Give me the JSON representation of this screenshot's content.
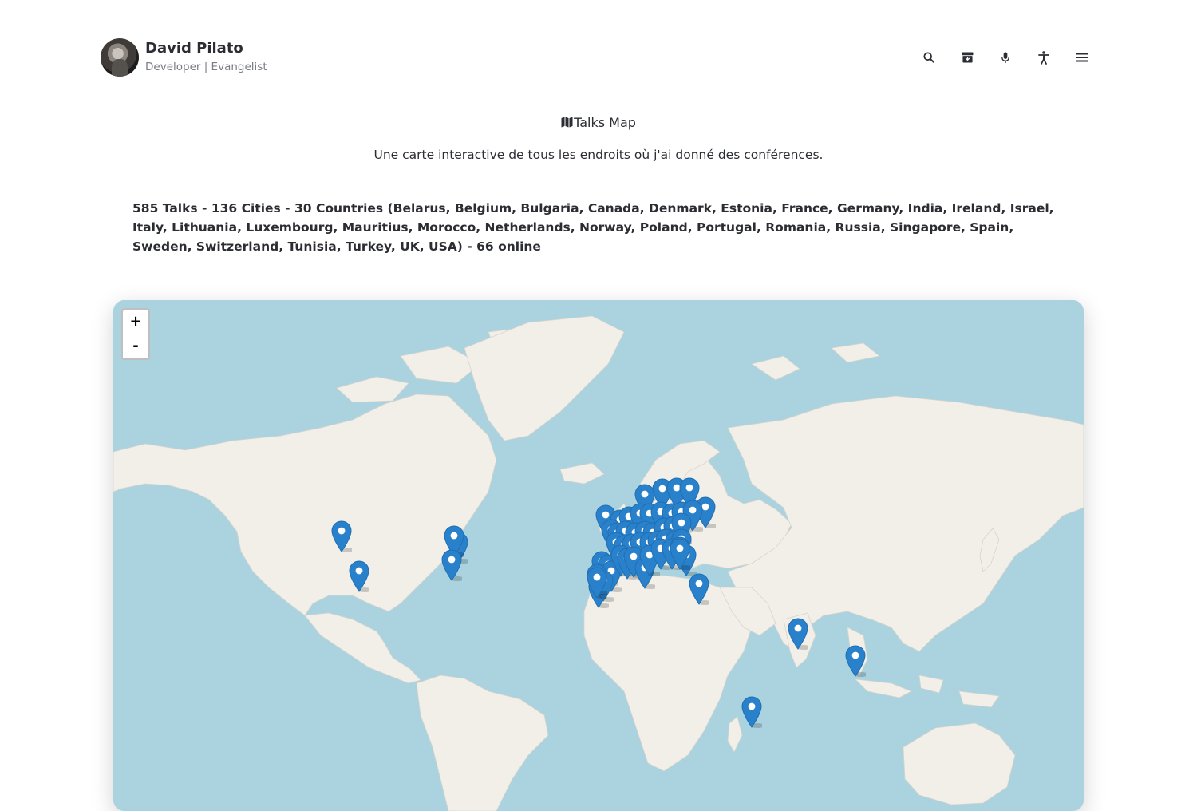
{
  "header": {
    "name": "David Pilato",
    "subtitle": "Developer | Evangelist",
    "nav": [
      {
        "icon": "search-icon"
      },
      {
        "icon": "archive-icon"
      },
      {
        "icon": "microphone-icon"
      },
      {
        "icon": "accessibility-icon"
      },
      {
        "icon": "menu-icon"
      }
    ]
  },
  "page": {
    "title": "Talks Map",
    "lead": "Une carte interactive de tous les endroits où j'ai donné des conférences.",
    "stats": "585 Talks - 136 Cities - 30 Countries (Belarus, Belgium, Bulgaria, Canada, Denmark, Estonia, France, Germany, India, Ireland, Israel, Italy, Lithuania, Luxembourg, Mauritius, Morocco, Netherlands, Norway, Poland, Portugal, Romania, Russia, Singapore, Spain, Sweden, Switzerland, Tunisia, Turkey, UK, USA) - 66 online"
  },
  "map": {
    "zoom_in": "+",
    "zoom_out": "-",
    "colors": {
      "water": "#aad3df",
      "land": "#f2efe9",
      "marker": "#2a81cb"
    },
    "markers": 58
  }
}
